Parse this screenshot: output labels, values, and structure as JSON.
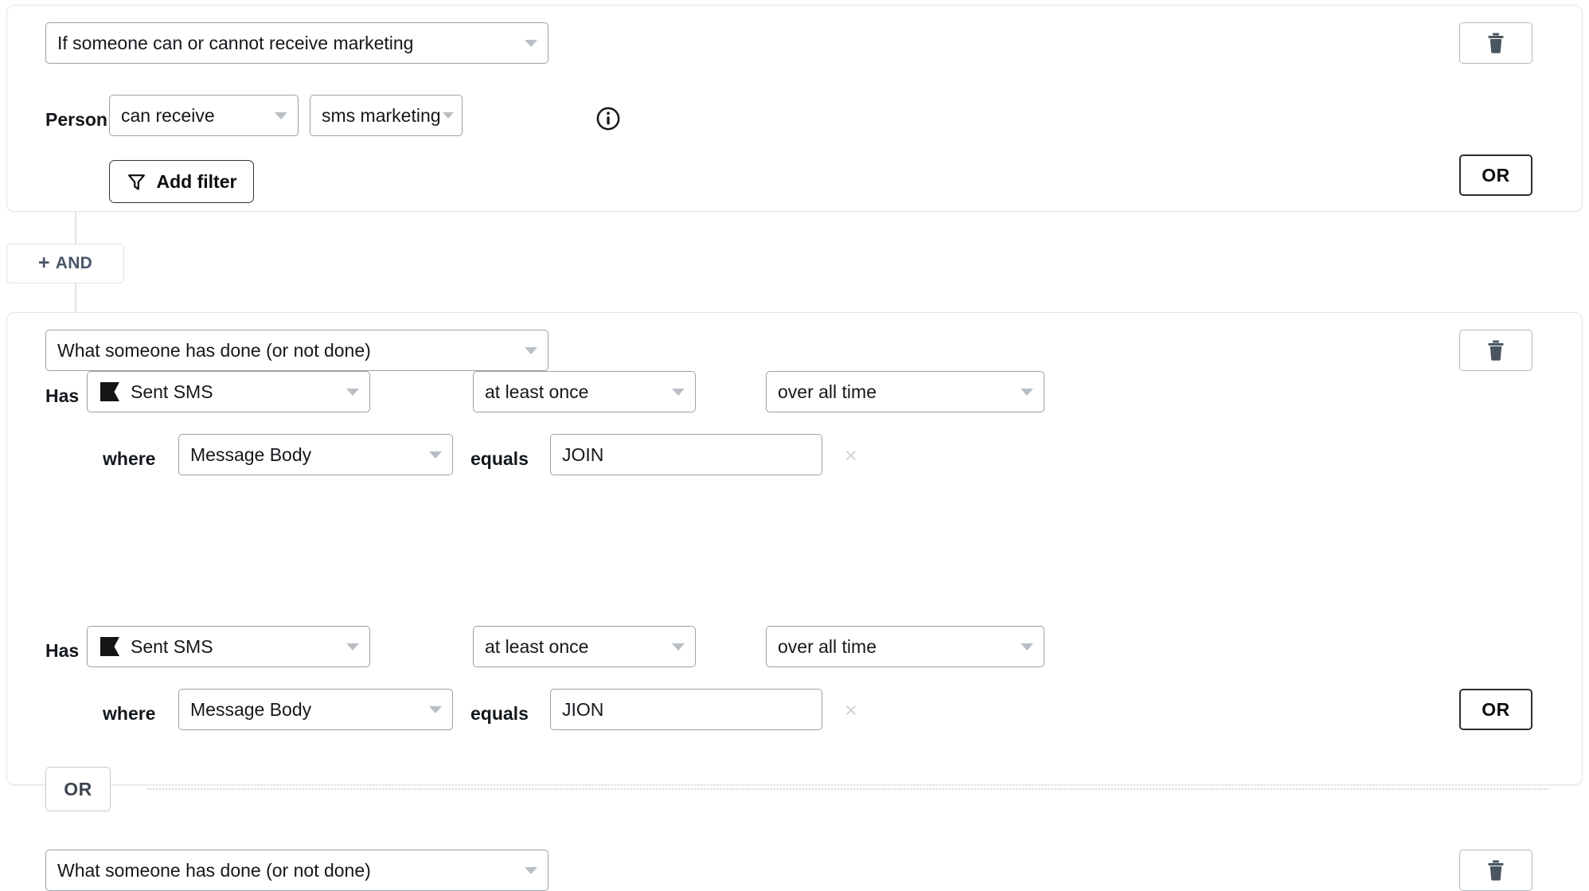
{
  "theme": {
    "background": "#ffffff",
    "card_border": "#e3e6e8",
    "control_border": "#9aa1a8",
    "text": "#14181c",
    "muted": "#4a5568",
    "caret": "#b9bfc5",
    "accent_dark": "#2b2f33",
    "icon_dark": "#4a5560",
    "divider_dotted": "#d4d9de"
  },
  "connector": {
    "and_button": {
      "plus": "+",
      "label": "AND",
      "icon": "plus-icon"
    }
  },
  "condition_group_1": {
    "type_select": {
      "value": "If someone can or cannot receive marketing",
      "icon": "chevron-down-icon"
    },
    "delete_button": {
      "icon": "trash-icon",
      "label": ""
    },
    "row": {
      "prefix_label": "Person",
      "consent_select": {
        "value": "can receive",
        "icon": "chevron-down-icon"
      },
      "channel_select": {
        "value": "sms marketing",
        "icon": "chevron-down-icon"
      },
      "info": {
        "icon": "info-circle-icon",
        "glyph": "i"
      }
    },
    "add_filter": {
      "label": "Add filter",
      "icon": "filter-icon"
    },
    "or_button": {
      "label": "OR"
    }
  },
  "condition_group_2": {
    "blocks": [
      {
        "type_select": {
          "value": "What someone has done (or not done)",
          "icon": "chevron-down-icon"
        },
        "delete_button": {
          "icon": "trash-icon"
        },
        "has_row": {
          "prefix_label": "Has",
          "metric_select": {
            "value": "Sent SMS",
            "icon": "klaviyo-flag-icon",
            "caret": "chevron-down-icon"
          },
          "frequency_select": {
            "value": "at least once",
            "icon": "chevron-down-icon"
          },
          "timeframe_select": {
            "value": "over all time",
            "icon": "chevron-down-icon"
          }
        },
        "where_row": {
          "where_label": "where",
          "property_select": {
            "value": "Message Body",
            "icon": "chevron-down-icon"
          },
          "operator_label": "equals",
          "value_input": {
            "value": "JOIN",
            "placeholder": ""
          },
          "clear_button": {
            "icon": "close-icon",
            "glyph": "×"
          }
        }
      },
      {
        "type_select": {
          "value": "What someone has done (or not done)",
          "icon": "chevron-down-icon"
        },
        "delete_button": {
          "icon": "trash-icon"
        },
        "has_row": {
          "prefix_label": "Has",
          "metric_select": {
            "value": "Sent SMS",
            "icon": "klaviyo-flag-icon",
            "caret": "chevron-down-icon"
          },
          "frequency_select": {
            "value": "at least once",
            "icon": "chevron-down-icon"
          },
          "timeframe_select": {
            "value": "over all time",
            "icon": "chevron-down-icon"
          }
        },
        "where_row": {
          "where_label": "where",
          "property_select": {
            "value": "Message Body",
            "icon": "chevron-down-icon"
          },
          "operator_label": "equals",
          "value_input": {
            "value": "JION",
            "placeholder": ""
          },
          "clear_button": {
            "icon": "close-icon",
            "glyph": "×"
          }
        },
        "or_button": {
          "label": "OR"
        }
      }
    ],
    "or_divider": {
      "label": "OR"
    }
  }
}
